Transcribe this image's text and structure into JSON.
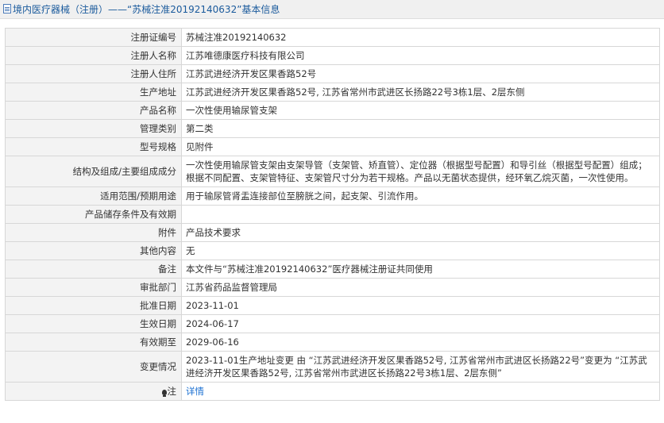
{
  "title_bar": {
    "text": "境内医疗器械（注册）——“苏械注准20192140632”基本信息"
  },
  "rows": [
    {
      "label": "注册证编号",
      "value": "苏械注准20192140632"
    },
    {
      "label": "注册人名称",
      "value": "江苏唯德康医疗科技有限公司"
    },
    {
      "label": "注册人住所",
      "value": "江苏武进经济开发区果香路52号"
    },
    {
      "label": "生产地址",
      "value": "江苏武进经济开发区果香路52号, 江苏省常州市武进区长扬路22号3栋1层、2层东侧"
    },
    {
      "label": "产品名称",
      "value": "一次性使用输尿管支架"
    },
    {
      "label": "管理类别",
      "value": "第二类"
    },
    {
      "label": "型号规格",
      "value": "见附件"
    },
    {
      "label": "结构及组成/主要组成成分",
      "value": "一次性使用输尿管支架由支架导管（支架管、矫直管）、定位器（根据型号配置）和导引丝（根据型号配置）组成；根据不同配置、支架管特征、支架管尺寸分为若干规格。产品以无菌状态提供，经环氧乙烷灭菌，一次性使用。"
    },
    {
      "label": "适用范围/预期用途",
      "value": "用于输尿管肾盂连接部位至膀胱之间，起支架、引流作用。"
    },
    {
      "label": "产品储存条件及有效期",
      "value": ""
    },
    {
      "label": "附件",
      "value": "产品技术要求"
    },
    {
      "label": "其他内容",
      "value": "无"
    },
    {
      "label": "备注",
      "value": "本文件与“苏械注准20192140632”医疗器械注册证共同使用"
    },
    {
      "label": "审批部门",
      "value": "江苏省药品监督管理局"
    },
    {
      "label": "批准日期",
      "value": "2023-11-01"
    },
    {
      "label": "生效日期",
      "value": "2024-06-17"
    },
    {
      "label": "有效期至",
      "value": "2029-06-16"
    },
    {
      "label": "变更情况",
      "value": "2023-11-01生产地址变更 由 “江苏武进经济开发区果香路52号, 江苏省常州市武进区长扬路22号”变更为 “江苏武进经济开发区果香路52号, 江苏省常州市武进区长扬路22号3栋1层、2层东侧”"
    }
  ],
  "note_row": {
    "label": "注",
    "link_text": "详情",
    "icon": "bulb-icon"
  }
}
